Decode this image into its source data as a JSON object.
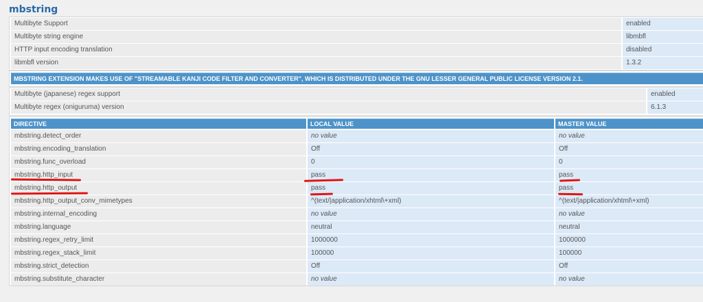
{
  "section": {
    "title": "mbstring"
  },
  "info_rows": [
    {
      "label": "Multibyte Support",
      "value": "enabled"
    },
    {
      "label": "Multibyte string engine",
      "value": "libmbfl"
    },
    {
      "label": "HTTP input encoding translation",
      "value": "disabled"
    },
    {
      "label": "libmbfl version",
      "value": "1.3.2"
    }
  ],
  "notice": "MBSTRING EXTENSION MAKES USE OF \"STREAMABLE KANJI CODE FILTER AND CONVERTER\", WHICH IS DISTRIBUTED UNDER THE GNU LESSER GENERAL PUBLIC LICENSE VERSION 2.1.",
  "regex_rows": [
    {
      "label": "Multibyte (japanese) regex support",
      "value": "enabled"
    },
    {
      "label": "Multibyte regex (oniguruma) version",
      "value": "6.1.3"
    }
  ],
  "directives": {
    "headers": [
      "DIRECTIVE",
      "LOCAL VALUE",
      "MASTER VALUE"
    ],
    "rows": [
      {
        "name": "mbstring.detect_order",
        "local": "no value",
        "master": "no value"
      },
      {
        "name": "mbstring.encoding_translation",
        "local": "Off",
        "master": "Off"
      },
      {
        "name": "mbstring.func_overload",
        "local": "0",
        "master": "0"
      },
      {
        "name": "mbstring.http_input",
        "local": "pass",
        "master": "pass"
      },
      {
        "name": "mbstring.http_output",
        "local": "pass",
        "master": "pass"
      },
      {
        "name": "mbstring.http_output_conv_mimetypes",
        "local": "^(text/|application/xhtml\\+xml)",
        "master": "^(text/|application/xhtml\\+xml)"
      },
      {
        "name": "mbstring.internal_encoding",
        "local": "no value",
        "master": "no value"
      },
      {
        "name": "mbstring.language",
        "local": "neutral",
        "master": "neutral"
      },
      {
        "name": "mbstring.regex_retry_limit",
        "local": "1000000",
        "master": "1000000"
      },
      {
        "name": "mbstring.regex_stack_limit",
        "local": "100000",
        "master": "100000"
      },
      {
        "name": "mbstring.strict_detection",
        "local": "Off",
        "master": "Off"
      },
      {
        "name": "mbstring.substitute_character",
        "local": "no value",
        "master": "no value"
      }
    ]
  },
  "colors": {
    "accent": "#4d93c9",
    "title": "#2a6aa8",
    "annotation": "#e01414"
  }
}
